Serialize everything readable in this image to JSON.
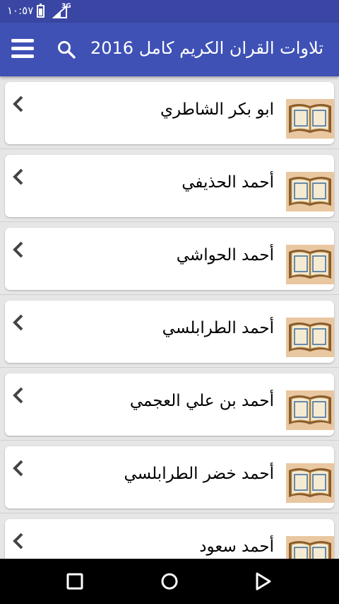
{
  "status_bar": {
    "time": "١٠:٥٧",
    "network_type": "3G",
    "icons": [
      "battery-charging-icon",
      "signal-icon"
    ]
  },
  "app_bar": {
    "title": "تلاوات القران الكريم كامل 2016",
    "menu_icon": "hamburger-menu-icon",
    "search_icon": "search-icon",
    "color": "#3f51b5"
  },
  "reciters": [
    {
      "name": "ابو بكر الشاطري"
    },
    {
      "name": "أحمد الحذيفي"
    },
    {
      "name": "أحمد الحواشي"
    },
    {
      "name": "أحمد الطرابلسي"
    },
    {
      "name": "أحمد بن علي العجمي"
    },
    {
      "name": "أحمد خضر الطرابلسي"
    },
    {
      "name": "أحمد سعود"
    }
  ],
  "list_item_icons": {
    "leading": "open-book-icon",
    "trailing": "chevron-left-icon"
  },
  "nav_bar": {
    "buttons": [
      "back-icon",
      "home-icon",
      "recents-icon"
    ]
  },
  "colors": {
    "status_bar": "#3a46a3",
    "app_bar": "#3f51b5",
    "background": "#e6e6e6",
    "card": "#ffffff"
  }
}
